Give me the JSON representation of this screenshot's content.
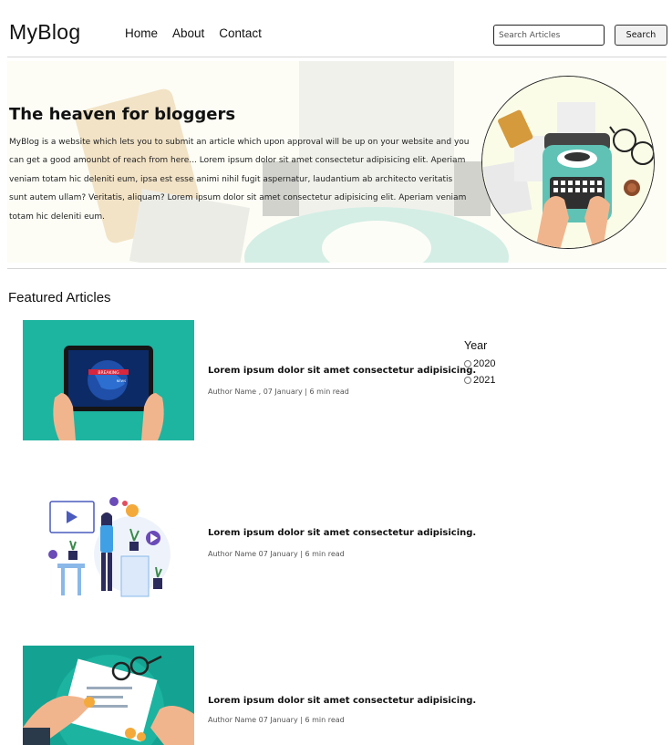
{
  "header": {
    "logo": "MyBlog",
    "nav": [
      "Home",
      "About",
      "Contact"
    ],
    "search_placeholder": "Search Articles",
    "search_button": "Search"
  },
  "hero": {
    "title": "The heaven for bloggers",
    "text": "MyBlog is a website which lets you to submit an article which upon approval will be up on your website and you can get a good amounbt of reach from here... Lorem ipsum dolor sit amet consectetur adipisicing elit. Aperiam veniam totam hic deleniti eum, ipsa est esse animi nihil fugit aspernatur, laudantium ab architecto veritatis sunt autem ullam? Veritatis, aliquam? Lorem ipsum dolor sit amet consectetur adipisicing elit. Aperiam veniam totam hic deleniti eum."
  },
  "featured": {
    "title": "Featured Articles",
    "articles": [
      {
        "title": "Lorem ipsum dolor sit amet consectetur adipisicing.",
        "meta": "Author Name , 07 January | 6 min read",
        "image_text": "BREAKING NEWS",
        "image_icon": "tablet-breaking-news-icon"
      },
      {
        "title": "Lorem ipsum dolor sit amet consectetur adipisicing.",
        "meta": "Author Name 07 January | 6 min read",
        "image_icon": "woman-video-content-icon"
      },
      {
        "title": "Lorem ipsum dolor sit amet consectetur adipisicing.",
        "meta": "Author Name 07 January | 6 min read",
        "image_icon": "finance-documents-icon"
      }
    ]
  },
  "filter": {
    "title": "Year",
    "options": [
      "2020",
      "2021"
    ]
  },
  "colors": {
    "teal": "#1db4a0",
    "hero_bg": "#fdfdf6",
    "typewriter": "#5fc2b5"
  }
}
